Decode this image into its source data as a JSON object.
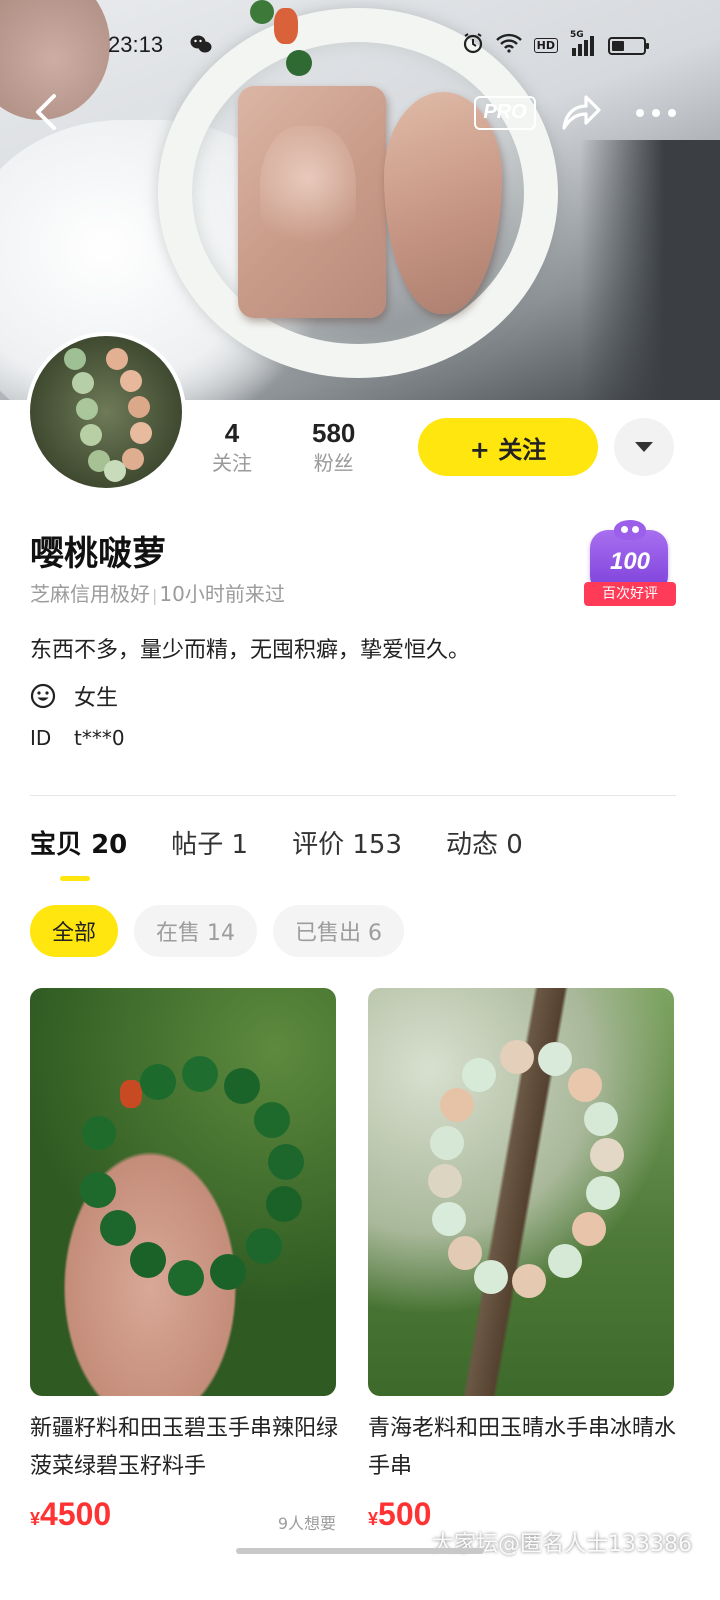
{
  "status_bar": {
    "time": "23:13",
    "network": "5G",
    "hd": "HD"
  },
  "header": {
    "pro_label": "PRO"
  },
  "profile": {
    "following_count": "4",
    "following_label": "关注",
    "followers_count": "580",
    "followers_label": "粉丝",
    "follow_button_label": "+ 关注",
    "username": "嘤桃啵萝",
    "credit": "芝麻信用极好",
    "last_seen": "10小时前来过",
    "bio": "东西不多，量少而精，无囤积癖，挚爱恒久。",
    "gender": "女生",
    "id_label": "ID",
    "id_value": "t***0",
    "rating_badge_number": "100",
    "rating_badge_label": "百次好评"
  },
  "tabs": [
    {
      "label": "宝贝",
      "count": "20",
      "active": true
    },
    {
      "label": "帖子",
      "count": "1",
      "active": false
    },
    {
      "label": "评价",
      "count": "153",
      "active": false
    },
    {
      "label": "动态",
      "count": "0",
      "active": false
    }
  ],
  "filters": [
    {
      "label": "全部",
      "active": true
    },
    {
      "label": "在售 14",
      "active": false
    },
    {
      "label": "已售出 6",
      "active": false
    }
  ],
  "products": [
    {
      "title": "新疆籽料和田玉碧玉手串辣阳绿菠菜绿碧玉籽料手",
      "currency": "¥",
      "price": "4500",
      "wants": "9人想要"
    },
    {
      "title": "青海老料和田玉晴水手串冰晴水手串",
      "currency": "¥",
      "price": "500",
      "wants": ""
    }
  ],
  "watermark": "大家坛@匿名人士133386",
  "colors": {
    "accent_yellow": "#ffe60f",
    "price_red": "#ff3333",
    "badge_purple": "#7b3fd9",
    "badge_red": "#ff3b58"
  }
}
